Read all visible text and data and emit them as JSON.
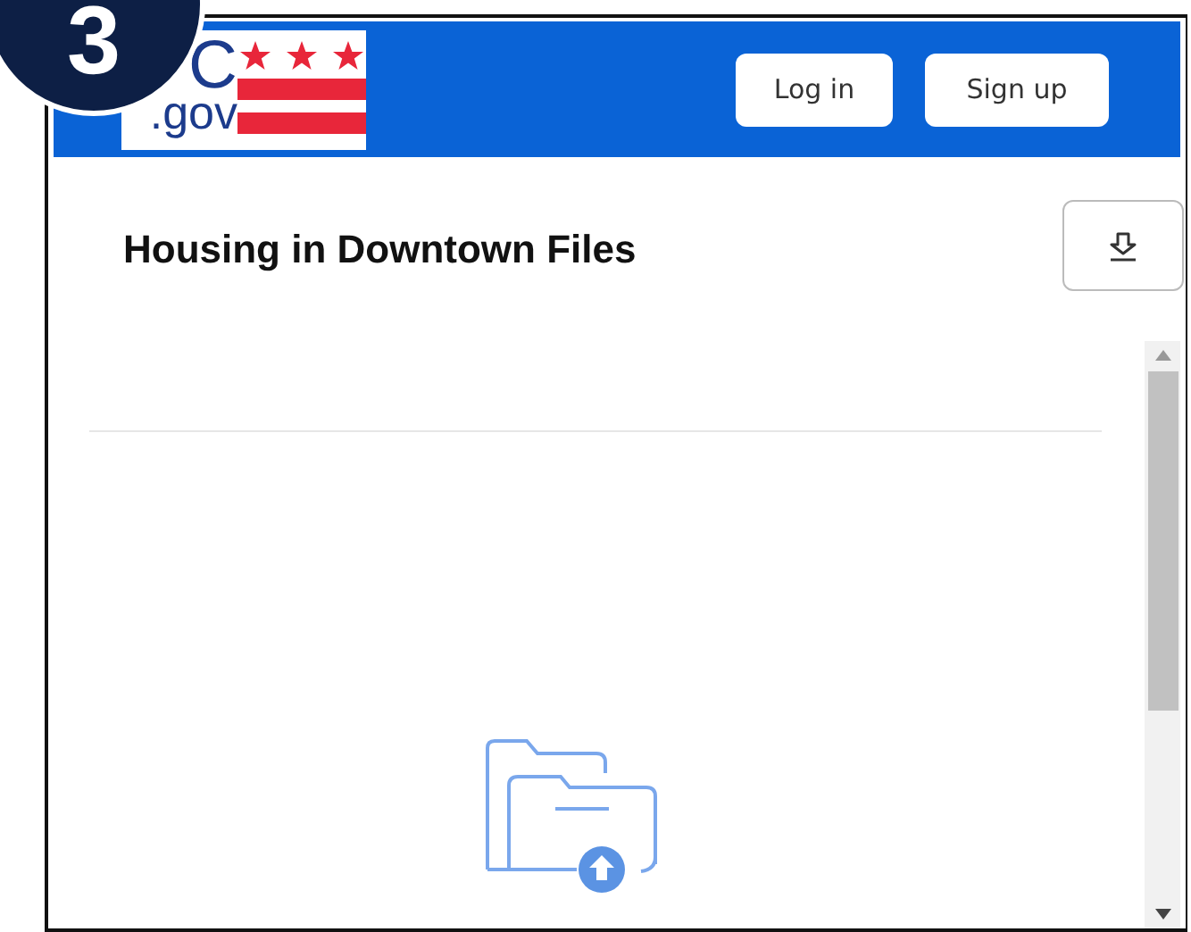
{
  "step_badge": "3",
  "header": {
    "logo": {
      "top": "C",
      "bottom": ".gov"
    },
    "buttons": [
      "Log in",
      "Sign up"
    ]
  },
  "page": {
    "title": "Housing in Downtown Files"
  }
}
